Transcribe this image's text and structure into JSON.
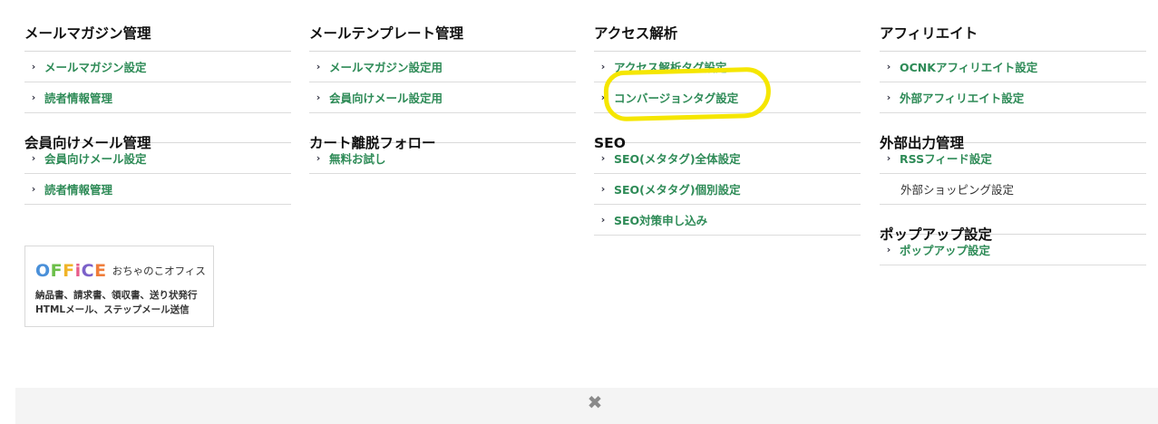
{
  "col1": {
    "sec1_title": "メールマガジン管理",
    "sec1_items": [
      "メールマガジン設定",
      "読者情報管理"
    ],
    "sec2_title": "会員向けメール管理",
    "sec2_items": [
      "会員向けメール設定",
      "読者情報管理"
    ]
  },
  "col2": {
    "sec1_title": "メールテンプレート管理",
    "sec1_items": [
      "メールマガジン設定用",
      "会員向けメール設定用"
    ],
    "sec2_title": "カート離脱フォロー",
    "sec2_items": [
      "無料お試し"
    ]
  },
  "col3": {
    "sec1_title": "アクセス解析",
    "sec1_items": [
      "アクセス解析タグ設定",
      "コンバージョンタグ設定"
    ],
    "sec2_title": "SEO",
    "sec2_items": [
      "SEO(メタタグ)全体設定",
      "SEO(メタタグ)個別設定",
      "SEO対策申し込み"
    ]
  },
  "col4": {
    "sec1_title": "アフィリエイト",
    "sec1_items": [
      "OCNKアフィリエイト設定",
      "外部アフィリエイト設定"
    ],
    "sec2_title": "外部出力管理",
    "sec2_items": [
      "RSSフィード設定",
      "外部ショッピング設定"
    ],
    "sec3_title": "ポップアップ設定",
    "sec3_items": [
      "ポップアップ設定"
    ]
  },
  "office": {
    "logo_letters": [
      "O",
      "F",
      "F",
      "i",
      "C",
      "E"
    ],
    "logo_sub": "おちゃのこオフィス",
    "desc_line1": "納品書、請求書、領収書、送り状発行",
    "desc_line2": "HTMLメール、ステップメール送信"
  },
  "icons": {
    "chevron": "chevron-right-icon",
    "close": "close-icon"
  },
  "colors": {
    "link_green": "#2e8b57",
    "highlight_yellow": "#f5e600"
  }
}
